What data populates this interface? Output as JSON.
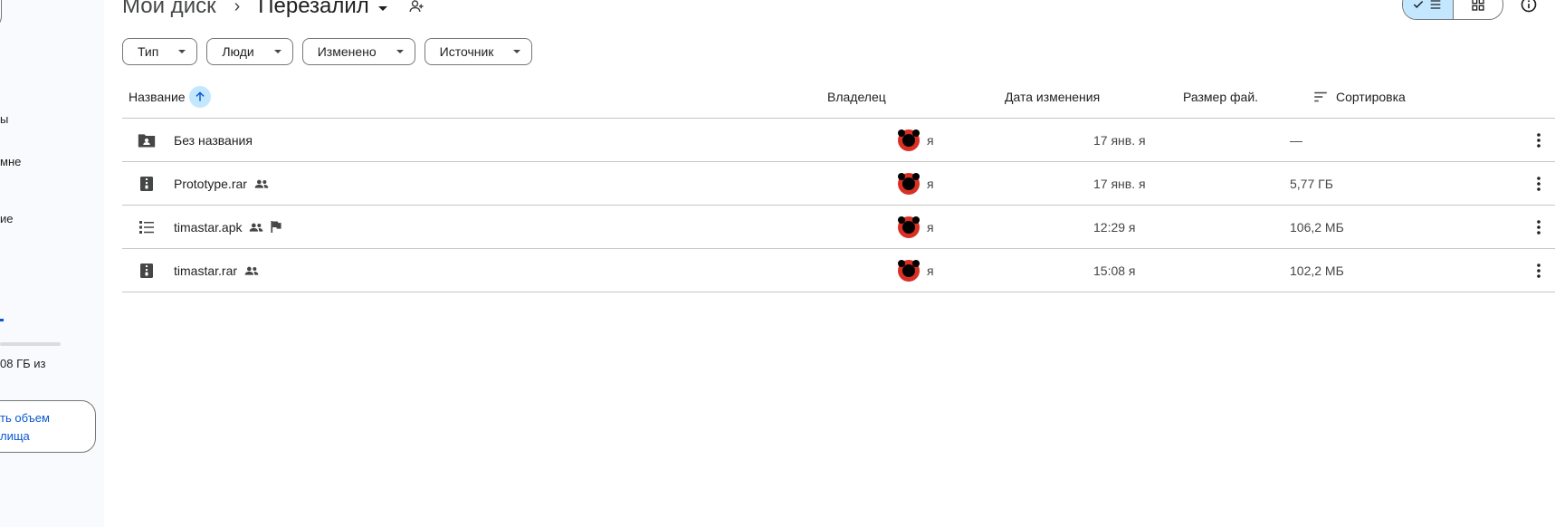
{
  "sidebar": {
    "items": [
      {
        "label": "ы"
      },
      {
        "label": "мне"
      },
      {
        "label": "ие"
      }
    ],
    "storage_text": "08 ГБ из",
    "storage_button": [
      "ть объем",
      "лища"
    ]
  },
  "breadcrumb": {
    "root": "Мой диск",
    "separator": "›",
    "current": "Перезалил"
  },
  "filters": [
    {
      "label": "Тип"
    },
    {
      "label": "Люди"
    },
    {
      "label": "Изменено"
    },
    {
      "label": "Источник"
    }
  ],
  "table": {
    "headers": {
      "name": "Название",
      "owner": "Владелец",
      "modified": "Дата изменения",
      "size": "Размер фай.",
      "sort": "Сортировка"
    },
    "rows": [
      {
        "name": "Без названия",
        "icon": "shared-folder-icon",
        "owner": "я",
        "modified": "17 янв. я",
        "size": "—"
      },
      {
        "name": "Prototype.rar",
        "icon": "archive-icon",
        "shared": true,
        "owner": "я",
        "modified": "17 янв. я",
        "size": "5,77 ГБ"
      },
      {
        "name": "timastar.apk",
        "icon": "apk-list-icon",
        "shared": true,
        "flagged": true,
        "owner": "я",
        "modified": "12:29 я",
        "size": "106,2 МБ"
      },
      {
        "name": "timastar.rar",
        "icon": "archive-icon",
        "shared": true,
        "owner": "я",
        "modified": "15:08 я",
        "size": "102,2 МБ"
      }
    ]
  },
  "colors": {
    "accent": "#0b57d0",
    "selected": "#c2e7ff",
    "sidebar_bg": "#f8fafd",
    "divider": "#c4c7c5"
  }
}
